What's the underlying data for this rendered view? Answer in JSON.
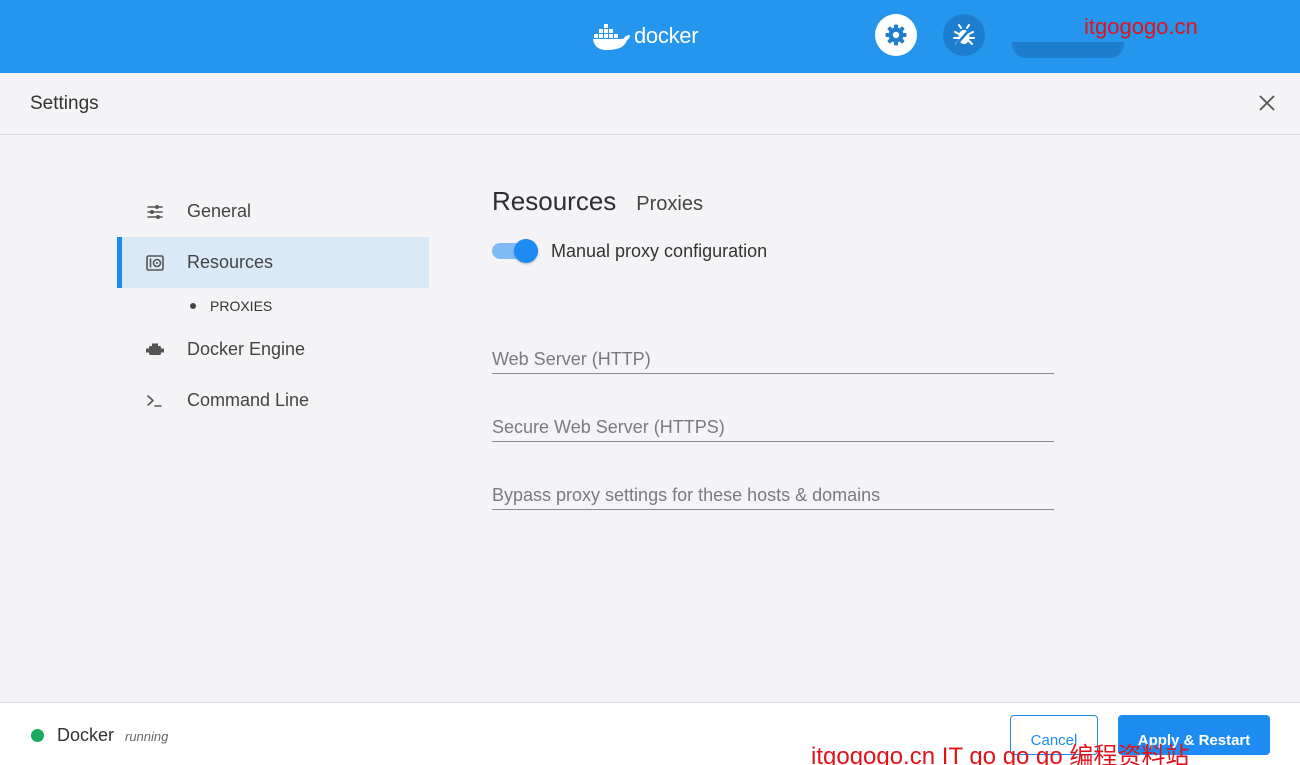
{
  "topbar": {
    "logo_text": "docker",
    "logo_icon": "docker-whale-icon",
    "settings_icon": "gear-icon",
    "troubleshoot_icon": "bug-icon",
    "brand_color": "#2496ed",
    "watermark": "itgogogo.cn"
  },
  "header": {
    "title": "Settings",
    "close_icon": "close-icon"
  },
  "sidebar": {
    "items": [
      {
        "label": "General",
        "icon": "sliders-icon",
        "active": false
      },
      {
        "label": "Resources",
        "icon": "disk-icon",
        "active": true
      },
      {
        "label": "Docker Engine",
        "icon": "engine-icon",
        "active": false
      },
      {
        "label": "Command Line",
        "icon": "terminal-icon",
        "active": false
      }
    ],
    "sub_items": [
      {
        "label": "PROXIES"
      }
    ]
  },
  "main": {
    "title": "Resources",
    "subtitle": "Proxies",
    "toggle": {
      "label": "Manual proxy configuration",
      "on": true
    },
    "fields": [
      {
        "placeholder": "Web Server (HTTP)",
        "value": ""
      },
      {
        "placeholder": "Secure Web Server (HTTPS)",
        "value": ""
      },
      {
        "placeholder": "Bypass proxy settings for these hosts & domains",
        "value": ""
      }
    ]
  },
  "footer": {
    "app_name": "Docker",
    "status": "running",
    "status_color": "#1ba85f",
    "cancel_label": "Cancel",
    "apply_label": "Apply & Restart",
    "watermark": "itgogogo.cn IT go go go 编程资料站"
  },
  "accent_color": "#1d8bf1"
}
